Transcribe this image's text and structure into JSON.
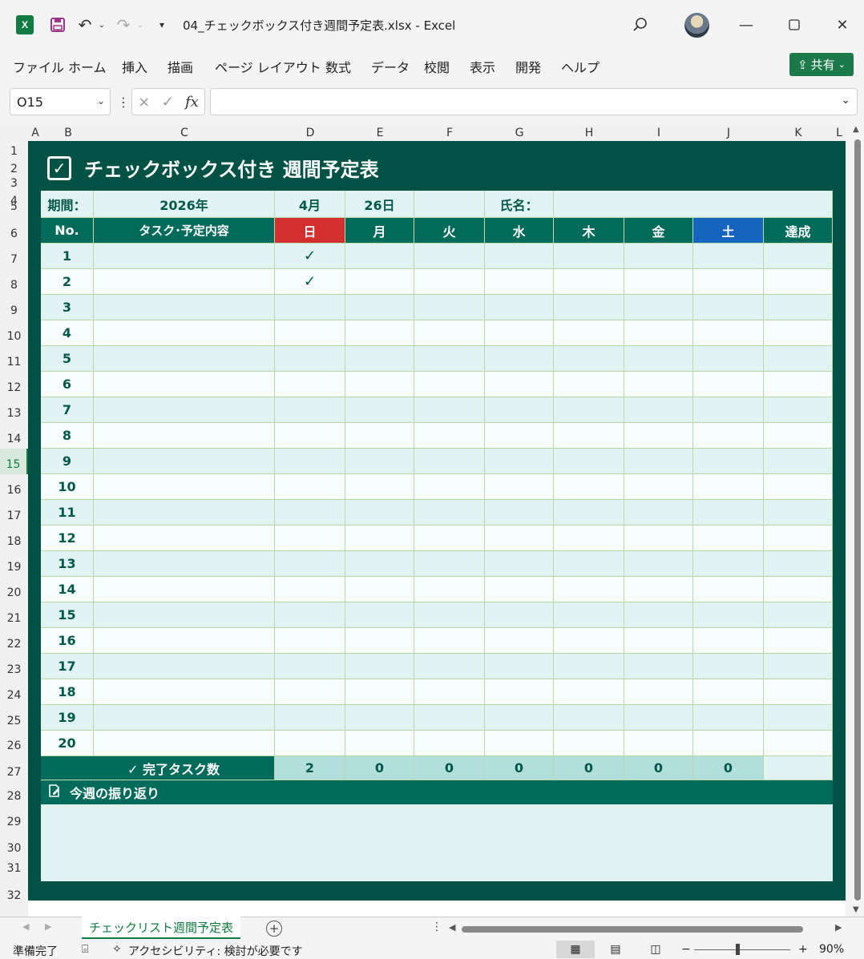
{
  "window": {
    "filename": "04_チェックボックス付き週間予定表.xlsx",
    "separator": "-",
    "app": "Excel",
    "app_icon": "excel-icon",
    "title_full": "04_チェックボックス付き週間予定表.xlsx  -  Excel"
  },
  "menu": {
    "items": [
      "ファイル",
      "ホーム",
      "挿入",
      "描画",
      "ページ レイアウト",
      "数式",
      "データ",
      "校閲",
      "表示",
      "開発",
      "ヘルプ"
    ],
    "share_label": "共有"
  },
  "formula_bar": {
    "name_box": "O15",
    "cancel_glyph": "×",
    "enter_glyph": "✓",
    "fx_label": "fx",
    "formula": ""
  },
  "grid": {
    "columns": [
      "A",
      "B",
      "C",
      "D",
      "E",
      "F",
      "G",
      "H",
      "I",
      "J",
      "K",
      "L"
    ],
    "rows": [
      "1",
      "2",
      "3",
      "4",
      "5",
      "6",
      "7",
      "8",
      "9",
      "10",
      "11",
      "12",
      "13",
      "14",
      "15",
      "16",
      "17",
      "18",
      "19",
      "20",
      "21",
      "22",
      "23",
      "24",
      "25",
      "26",
      "27",
      "28",
      "29",
      "30",
      "31",
      "32"
    ],
    "selected_row": "15"
  },
  "sheet": {
    "title": "チェックボックス付き 週間予定表",
    "period_label": "期間：",
    "year": "2026年",
    "month": "4月",
    "day": "26日",
    "name_label": "氏名：",
    "name_value": "",
    "headers": {
      "no": "No.",
      "task": "タスク･予定内容",
      "days": [
        "日",
        "月",
        "火",
        "水",
        "木",
        "金",
        "土"
      ],
      "achieved": "達成"
    },
    "check_glyph": "✓",
    "tasks": [
      {
        "no": "1",
        "content": "",
        "checks": [
          true,
          false,
          false,
          false,
          false,
          false,
          false
        ],
        "achieved": ""
      },
      {
        "no": "2",
        "content": "",
        "checks": [
          true,
          false,
          false,
          false,
          false,
          false,
          false
        ],
        "achieved": ""
      },
      {
        "no": "3",
        "content": "",
        "checks": [
          false,
          false,
          false,
          false,
          false,
          false,
          false
        ],
        "achieved": ""
      },
      {
        "no": "4",
        "content": "",
        "checks": [
          false,
          false,
          false,
          false,
          false,
          false,
          false
        ],
        "achieved": ""
      },
      {
        "no": "5",
        "content": "",
        "checks": [
          false,
          false,
          false,
          false,
          false,
          false,
          false
        ],
        "achieved": ""
      },
      {
        "no": "6",
        "content": "",
        "checks": [
          false,
          false,
          false,
          false,
          false,
          false,
          false
        ],
        "achieved": ""
      },
      {
        "no": "7",
        "content": "",
        "checks": [
          false,
          false,
          false,
          false,
          false,
          false,
          false
        ],
        "achieved": ""
      },
      {
        "no": "8",
        "content": "",
        "checks": [
          false,
          false,
          false,
          false,
          false,
          false,
          false
        ],
        "achieved": ""
      },
      {
        "no": "9",
        "content": "",
        "checks": [
          false,
          false,
          false,
          false,
          false,
          false,
          false
        ],
        "achieved": ""
      },
      {
        "no": "10",
        "content": "",
        "checks": [
          false,
          false,
          false,
          false,
          false,
          false,
          false
        ],
        "achieved": ""
      },
      {
        "no": "11",
        "content": "",
        "checks": [
          false,
          false,
          false,
          false,
          false,
          false,
          false
        ],
        "achieved": ""
      },
      {
        "no": "12",
        "content": "",
        "checks": [
          false,
          false,
          false,
          false,
          false,
          false,
          false
        ],
        "achieved": ""
      },
      {
        "no": "13",
        "content": "",
        "checks": [
          false,
          false,
          false,
          false,
          false,
          false,
          false
        ],
        "achieved": ""
      },
      {
        "no": "14",
        "content": "",
        "checks": [
          false,
          false,
          false,
          false,
          false,
          false,
          false
        ],
        "achieved": ""
      },
      {
        "no": "15",
        "content": "",
        "checks": [
          false,
          false,
          false,
          false,
          false,
          false,
          false
        ],
        "achieved": ""
      },
      {
        "no": "16",
        "content": "",
        "checks": [
          false,
          false,
          false,
          false,
          false,
          false,
          false
        ],
        "achieved": ""
      },
      {
        "no": "17",
        "content": "",
        "checks": [
          false,
          false,
          false,
          false,
          false,
          false,
          false
        ],
        "achieved": ""
      },
      {
        "no": "18",
        "content": "",
        "checks": [
          false,
          false,
          false,
          false,
          false,
          false,
          false
        ],
        "achieved": ""
      },
      {
        "no": "19",
        "content": "",
        "checks": [
          false,
          false,
          false,
          false,
          false,
          false,
          false
        ],
        "achieved": ""
      },
      {
        "no": "20",
        "content": "",
        "checks": [
          false,
          false,
          false,
          false,
          false,
          false,
          false
        ],
        "achieved": ""
      }
    ],
    "totals_label": "✓ 完了タスク数",
    "totals": [
      "2",
      "0",
      "0",
      "0",
      "0",
      "0",
      "0"
    ],
    "totals_achieved": "",
    "reflection_label": "今週の振り返り",
    "reflection_text": ""
  },
  "tabs": {
    "active": "チェックリスト週間予定表",
    "add_glyph": "+"
  },
  "status": {
    "ready": "準備完了",
    "accessibility": "アクセシビリティ: 検討が必要です",
    "zoom": "90%",
    "zoom_minus": "−",
    "zoom_plus": "+"
  },
  "colors": {
    "panel": "#005244",
    "header": "#006b5a",
    "sunday": "#d32f2f",
    "saturday": "#1565c0",
    "row_odd": "#e0f2f2",
    "row_even": "#f8fdfd",
    "totals": "#b2dfdb",
    "text": "#00584a",
    "excel_green": "#107c41"
  }
}
